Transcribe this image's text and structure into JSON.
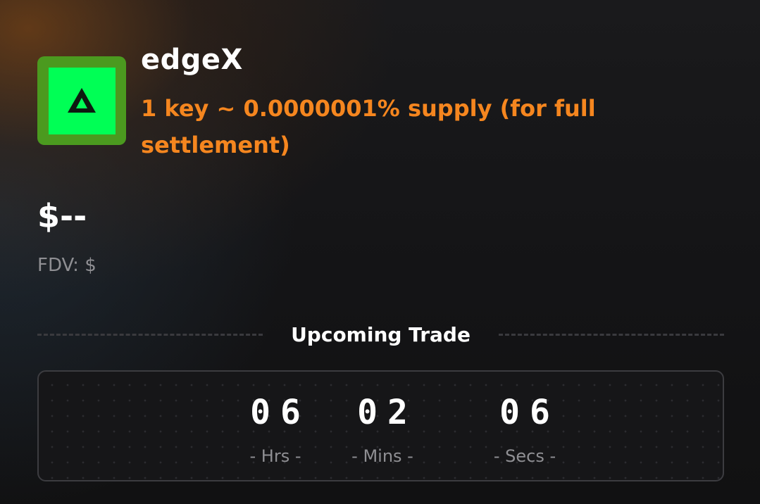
{
  "token": {
    "name": "edgeX",
    "logo_icon": "edgex-triangle-logo",
    "description": "1 key ~ 0.0000001% supply (for full settlement)",
    "accent_color": "#f5861f",
    "logo_bg": "#00ff55"
  },
  "price": {
    "value": "$--",
    "fdv": "FDV: $"
  },
  "section": {
    "title": "Upcoming Trade"
  },
  "countdown": {
    "hours": "06",
    "minutes": "02",
    "seconds": "06",
    "hours_label": "- Hrs -",
    "minutes_label": "- Mins -",
    "seconds_label": "- Secs -"
  }
}
